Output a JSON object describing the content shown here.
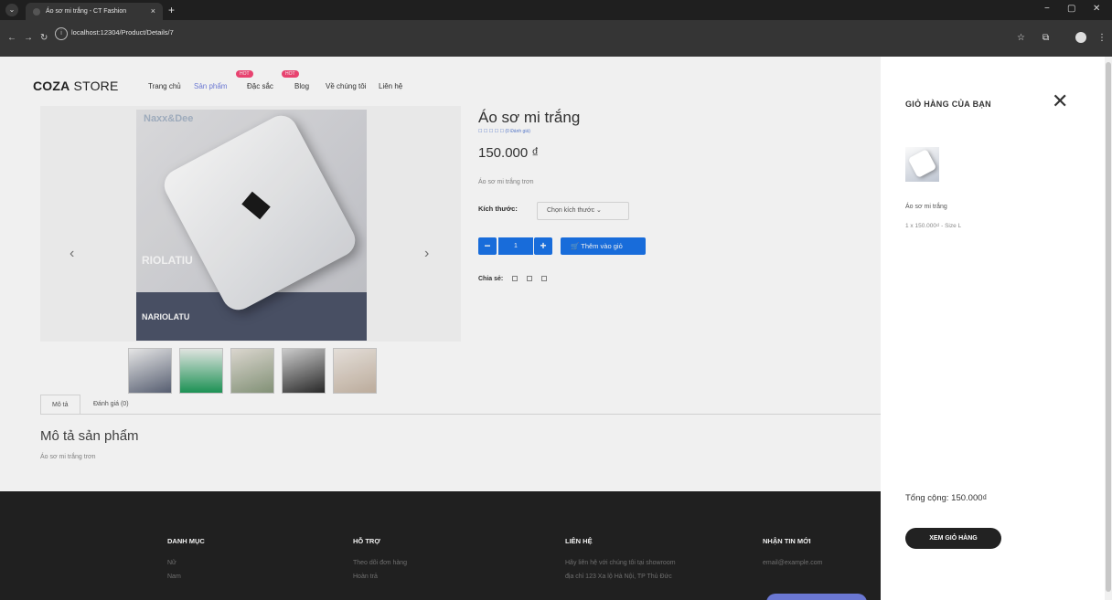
{
  "browser": {
    "tab_title": "Áo sơ mi trắng - CT Fashion",
    "tab_close": "×",
    "new_tab": "+",
    "url": "localhost:12304/Product/Details/7",
    "win_min": "−",
    "win_max": "▢",
    "win_close": "✕"
  },
  "header": {
    "logo_bold": "COZA",
    "logo_rest": " STORE",
    "menu": [
      {
        "label": "Trang chủ"
      },
      {
        "label": "Sản phẩm",
        "badge": "HOT"
      },
      {
        "label": "Đặc sắc",
        "badge": "HOT"
      },
      {
        "label": "Blog"
      },
      {
        "label": "Về chúng tôi"
      },
      {
        "label": "Liên hệ"
      }
    ]
  },
  "product": {
    "image_brand": "Naxx&Dee",
    "image_print_1": "RIOLATIU",
    "image_print_2": "NARIOLATU",
    "title": "Áo sơ mi trắng",
    "rating_text": "☐ ☐ ☐ ☐ ☐  (0 Đánh giá)",
    "price": "150.000 ₫",
    "short_desc": "Áo sơ mi trắng trơn",
    "size_label": "Kích thước:",
    "size_select": "Chọn kích thước",
    "quantity": "1",
    "add_to_cart": "Thêm vào giỏ",
    "share_label": "Chia sẻ:",
    "prev_arrow": "‹",
    "next_arrow": "›"
  },
  "tabs": [
    {
      "label": "Mô tả"
    },
    {
      "label": "Đánh giá (0)"
    }
  ],
  "description": {
    "title": "Mô tả sản phẩm",
    "text": "Áo sơ mi trắng trơn"
  },
  "footer": {
    "col1": {
      "title": "DANH MỤC",
      "items": [
        "Nữ",
        "Nam"
      ]
    },
    "col2": {
      "title": "HỖ TRỢ",
      "items": [
        "Theo dõi đơn hàng",
        "Hoàn trả"
      ]
    },
    "col3": {
      "title": "LIÊN HỆ",
      "lines": [
        "Hãy liên hệ với chúng tôi tại showroom",
        "địa chỉ 123 Xa lộ Hà Nội, TP Thủ Đức"
      ]
    },
    "col4": {
      "title": "NHẬN TIN MỚI",
      "placeholder": "email@example.com"
    }
  },
  "cart": {
    "title": "GIỎ HÀNG CỦA BẠN",
    "close": "✕",
    "item_name": "Áo sơ mi trắng",
    "item_detail": "1 x 150.000₫ - Size L",
    "total": "Tổng cộng: 150.000₫",
    "view_button": "XEM GIỎ HÀNG"
  }
}
